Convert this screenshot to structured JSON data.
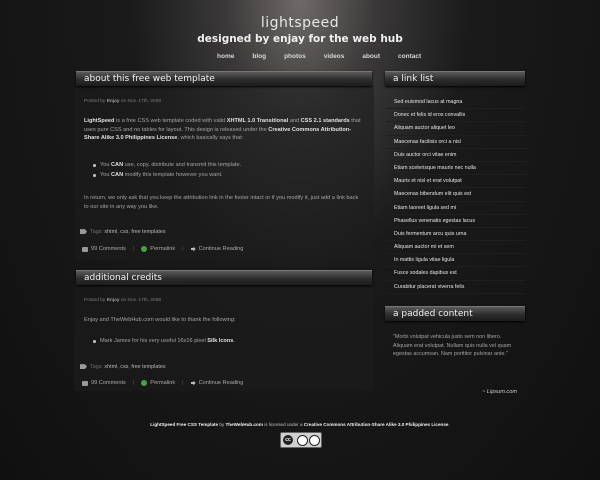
{
  "header": {
    "title": "lightspeed",
    "tagline": "designed by enjay for the web hub",
    "nav": [
      "home",
      "blog",
      "photos",
      "videos",
      "about",
      "contact"
    ]
  },
  "post1": {
    "heading": "about this free web template",
    "meta_prefix": "Posted by",
    "meta_author": "Enjay",
    "meta_date": "on Nov. 17th, 2008",
    "p1_a": "LightSpeed",
    "p1_b": " is a free CSS web template coded with valid ",
    "p1_c": "XHTML 1.0 Transitional",
    "p1_d": " and ",
    "p1_e": "CSS 2.1 standards",
    "p1_f": " that uses pure CSS and no tables for layout. This design is released under the ",
    "p1_g": "Creative Commons Attribution-Share Alike 3.0 Philippines License",
    "p1_h": ", which basically says that:",
    "bullet1_a": "You ",
    "bullet1_b": "CAN",
    "bullet1_c": " use, copy, distribute and transmit this template.",
    "bullet2_a": "You ",
    "bullet2_b": "CAN",
    "bullet2_c": " modify this template however you want.",
    "p2": "In return, we only ask that you keep the attribution link in the footer intact or if you modify it, just add a link back to our site in any way you like.",
    "tags_label": "Tags: ",
    "tags": [
      "xhtml",
      "css",
      "free templates"
    ],
    "comments": "99 Comments",
    "permalink": "Permalink",
    "continue": "Continue Reading"
  },
  "post2": {
    "heading": "additional credits",
    "meta_prefix": "Posted by",
    "meta_author": "Enjay",
    "meta_date": "on Nov. 17th, 2008",
    "p1": "Enjay and TheWebHub.com would like to thank the following:",
    "bullet1_a": "Mark James for his very useful 16x16 pixel ",
    "bullet1_b": "Silk Icons",
    "bullet1_c": ".",
    "tags_label": "Tags: ",
    "tags": [
      "xhtml",
      "css",
      "free templates"
    ],
    "comments": "99 Comments",
    "permalink": "Permalink",
    "continue": "Continue Reading"
  },
  "sidebar": {
    "links_heading": "a link list",
    "links": [
      "Sed euismod lacus at magna",
      "Donec et felis id eros convallis",
      "Aliquam auctor aliquet leo",
      "Maecenas facilisis orci a nisl",
      "Duis auctor orci vitae enim",
      "Etiam scelerisque mauris nec nulla",
      "Mauris et nisl et erat volutpat",
      "Maecenas bibendum elit quis est",
      "Etiam laoreet ligula sed mi",
      "Phasellus venenatis egestas lacus",
      "Duis fermentum arcu quis urna",
      "Aliquam auctor mi et sem",
      "In mattis ligula vitae ligula",
      "Fusce sodales dapibus est",
      "Curabitur placerat viverra felis"
    ],
    "padded_heading": "a padded content",
    "quote": "\"Morbi volutpat vehicula justo sem non libero. Aliquam erat volutpat. Nullam quis nulla vel quam egestas accumsan. Nam porttitor pulvinar ante.\"",
    "cite": "~ Lipsum.com"
  },
  "footer": {
    "a": "LightSpeed Free CSS Template",
    "b": " by ",
    "c": "TheWebHub.com",
    "d": " is licensed under a ",
    "e": "Creative Commons Attribution-Share Alike 3.0 Philippines License",
    "f": ".",
    "badge_cc": "cc"
  }
}
